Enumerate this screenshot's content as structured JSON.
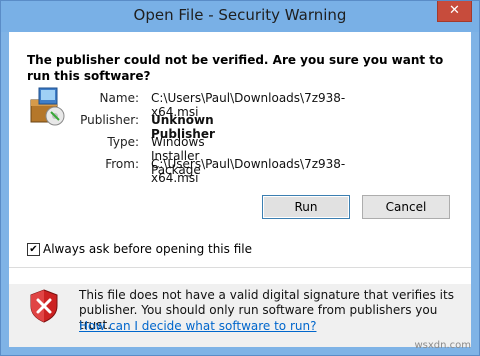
{
  "window": {
    "title": "Open File - Security Warning",
    "close_glyph": "✕"
  },
  "question": "The publisher could not be verified.  Are you sure you want to run this software?",
  "fields": [
    {
      "label": "Name:",
      "value": "C:\\Users\\Paul\\Downloads\\7z938-x64.msi",
      "bold": false
    },
    {
      "label": "Publisher:",
      "value": "Unknown Publisher",
      "bold": true
    },
    {
      "label": "Type:",
      "value": "Windows Installer Package",
      "bold": false
    },
    {
      "label": "From:",
      "value": "C:\\Users\\Paul\\Downloads\\7z938-x64.msi",
      "bold": false
    }
  ],
  "buttons": {
    "run": "Run",
    "cancel": "Cancel"
  },
  "checkbox": {
    "label": "Always ask before opening this file",
    "checked": true,
    "mark": "✔"
  },
  "warning": {
    "text": "This file does not have a valid digital signature that verifies its publisher.  You should only run software from publishers you trust.",
    "link": "How can I decide what software to run?"
  },
  "watermark": "wsxdn.com",
  "icons": {
    "package": "installer-package-icon",
    "shield": "security-shield-icon"
  },
  "colors": {
    "titlebar": "#79b0e6",
    "close": "#c74c3c",
    "link": "#0066cc",
    "shield": "#cc2222"
  }
}
